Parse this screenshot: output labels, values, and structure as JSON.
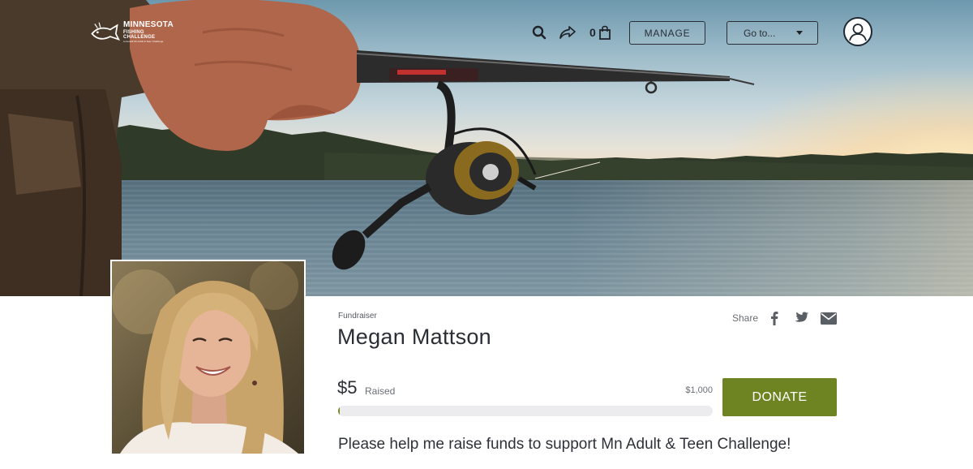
{
  "header": {
    "logo": {
      "line1": "MINNESOTA",
      "line2": "FISHING CHALLENGE",
      "line3": "to benefit Mn Adult & Teen Challenge"
    },
    "icons": [
      "search-icon",
      "share-arrow-icon",
      "shopping-bag-icon",
      "user-avatar-icon"
    ],
    "cart_count": "0",
    "manage_label": "MANAGE",
    "goto_label": "Go to..."
  },
  "profile": {
    "kicker": "Fundraiser",
    "name": "Megan Mattson",
    "share_label": "Share",
    "share_icons": [
      "facebook-icon",
      "twitter-icon",
      "email-icon"
    ]
  },
  "fundraising": {
    "raised": "$5",
    "raised_label": "Raised",
    "goal": "$1,000",
    "progress_fraction": 0.005,
    "donate_label": "DONATE",
    "tagline": "Please help me raise funds to support Mn Adult & Teen Challenge!"
  },
  "colors": {
    "donate": "#6e8422",
    "progress_track": "#ececee",
    "progress_fill": "#7a8a22"
  }
}
